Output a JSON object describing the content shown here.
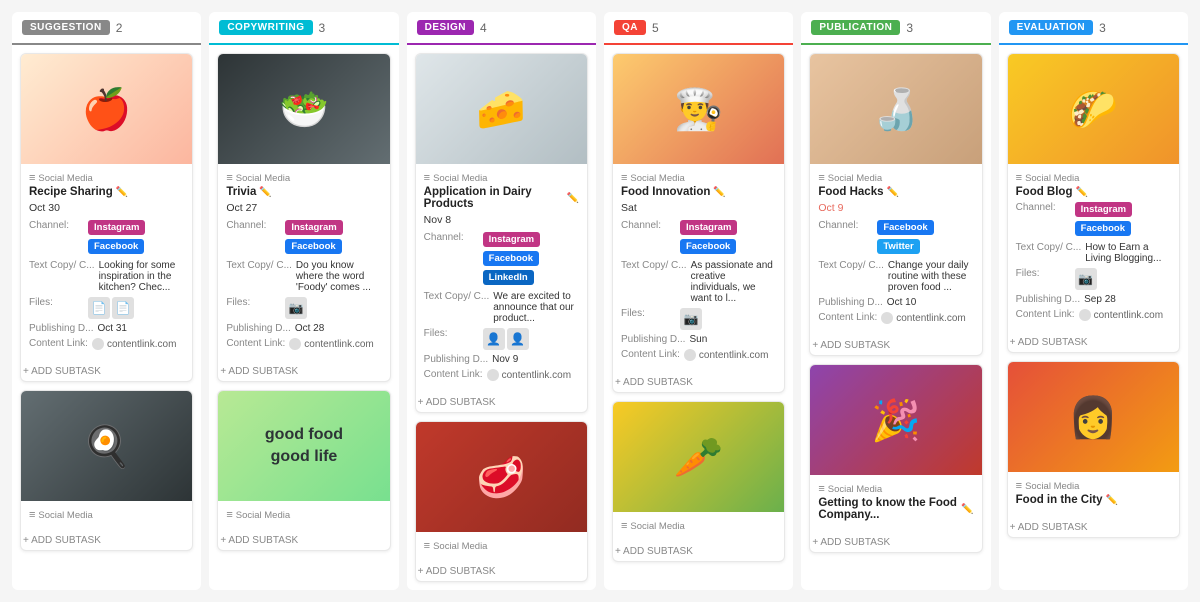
{
  "columns": [
    {
      "id": "suggestion",
      "label": "SUGGESTION",
      "badgeClass": "badge-suggestion",
      "colClass": "col-suggestion",
      "count": "2",
      "cards": [
        {
          "id": "card-1",
          "imgClass": "img-fruits",
          "imgEmoji": "🍎",
          "category": "Social Media",
          "title": "Recipe Sharing",
          "date": "Oct 30",
          "dateHighlight": false,
          "channels": [
            "Instagram",
            "Facebook"
          ],
          "textCopy": "Looking for some inspiration in the kitchen? Chec...",
          "files": [
            "📄",
            "📄"
          ],
          "publishingDate": "Oct 31",
          "contentLink": "contentlink.com"
        },
        {
          "id": "card-7",
          "imgClass": "img-pan",
          "imgEmoji": "🍳",
          "category": "Social Media",
          "title": "",
          "date": "",
          "dateHighlight": false,
          "channels": [],
          "textCopy": "",
          "files": [],
          "publishingDate": "",
          "contentLink": ""
        }
      ]
    },
    {
      "id": "copywriting",
      "label": "COPYWRITING",
      "badgeClass": "badge-copywriting",
      "colClass": "col-copywriting",
      "count": "3",
      "cards": [
        {
          "id": "card-2",
          "imgClass": "img-bowl",
          "imgEmoji": "🥗",
          "category": "Social Media",
          "title": "Trivia",
          "date": "Oct 27",
          "dateHighlight": false,
          "channels": [
            "Instagram",
            "Facebook"
          ],
          "textCopy": "Do you know where the word 'Foody' comes ...",
          "files": [
            "📷"
          ],
          "publishingDate": "Oct 28",
          "contentLink": "contentlink.com"
        },
        {
          "id": "card-8",
          "imgClass": "img-goodfood",
          "imgEmoji": "",
          "imgText": "good food\ngood life",
          "category": "Social Media",
          "title": "",
          "date": "",
          "dateHighlight": false,
          "channels": [],
          "textCopy": "",
          "files": [],
          "publishingDate": "",
          "contentLink": ""
        }
      ]
    },
    {
      "id": "design",
      "label": "DESIGN",
      "badgeClass": "badge-design",
      "colClass": "col-design",
      "count": "4",
      "cards": [
        {
          "id": "card-3",
          "imgClass": "img-dairy",
          "imgEmoji": "🧀",
          "category": "Social Media",
          "title": "Application in Dairy Products",
          "date": "Nov 8",
          "dateHighlight": false,
          "channels": [
            "Instagram",
            "Facebook",
            "LinkedIn"
          ],
          "textCopy": "We are excited to announce that our product...",
          "files": [
            "👤",
            "👤"
          ],
          "publishingDate": "Nov 9",
          "contentLink": "contentlink.com"
        },
        {
          "id": "card-9",
          "imgClass": "img-meat",
          "imgEmoji": "🥩",
          "category": "Social Media",
          "title": "",
          "date": "",
          "dateHighlight": false,
          "channels": [],
          "textCopy": "",
          "files": [],
          "publishingDate": "",
          "contentLink": ""
        }
      ]
    },
    {
      "id": "qa",
      "label": "QA",
      "badgeClass": "badge-qa",
      "colClass": "col-qa",
      "count": "5",
      "cards": [
        {
          "id": "card-4",
          "imgClass": "img-couple",
          "imgEmoji": "👨‍🍳",
          "category": "Social Media",
          "title": "Food Innovation",
          "date": "Sat",
          "dateHighlight": false,
          "channels": [
            "Instagram",
            "Facebook"
          ],
          "textCopy": "As passionate and creative individuals, we want to l...",
          "files": [
            "📷"
          ],
          "publishingDate": "Sun",
          "contentLink": "contentlink.com"
        },
        {
          "id": "card-10",
          "imgClass": "img-veggies",
          "imgEmoji": "🥕",
          "category": "Social Media",
          "title": "",
          "date": "",
          "dateHighlight": false,
          "channels": [],
          "textCopy": "",
          "files": [],
          "publishingDate": "",
          "contentLink": ""
        }
      ]
    },
    {
      "id": "publication",
      "label": "PUBLICATION",
      "badgeClass": "badge-publication",
      "colClass": "col-publication",
      "count": "3",
      "cards": [
        {
          "id": "card-5",
          "imgClass": "img-blender",
          "imgEmoji": "🍶",
          "category": "Social Media",
          "title": "Food Hacks",
          "date": "Oct 9",
          "dateHighlight": true,
          "channels": [
            "Facebook",
            "Twitter"
          ],
          "textCopy": "Change your daily routine with these proven food ...",
          "files": [],
          "publishingDate": "Oct 10",
          "contentLink": "contentlink.com"
        },
        {
          "id": "card-11",
          "imgClass": "img-gathering",
          "imgEmoji": "🎉",
          "category": "Social Media",
          "title": "Getting to know the Food Company...",
          "date": "",
          "dateHighlight": false,
          "channels": [],
          "textCopy": "",
          "files": [],
          "publishingDate": "",
          "contentLink": ""
        }
      ]
    },
    {
      "id": "evaluation",
      "label": "EVALUATION",
      "badgeClass": "badge-evaluation",
      "colClass": "col-evaluation",
      "count": "3",
      "cards": [
        {
          "id": "card-6",
          "imgClass": "img-nachos",
          "imgEmoji": "🌮",
          "category": "Social Media",
          "title": "Food Blog",
          "date": "",
          "dateHighlight": false,
          "channels": [
            "Instagram",
            "Facebook"
          ],
          "textCopy": "How to Earn a Living Blogging...",
          "files": [
            "📷"
          ],
          "publishingDate": "Sep 28",
          "contentLink": "contentlink.com"
        },
        {
          "id": "card-12",
          "imgClass": "img-women",
          "imgEmoji": "👩",
          "category": "Social Media",
          "title": "Food in the City",
          "date": "",
          "dateHighlight": false,
          "channels": [],
          "textCopy": "",
          "files": [],
          "publishingDate": "",
          "contentLink": ""
        }
      ]
    }
  ],
  "labels": {
    "channel": "Channel:",
    "textCopy": "Text Copy/ C...",
    "files": "Files:",
    "publishingDate": "Publishing D...",
    "contentLink": "Content Link:",
    "addSubtask": "+ ADD SUBTASK"
  }
}
